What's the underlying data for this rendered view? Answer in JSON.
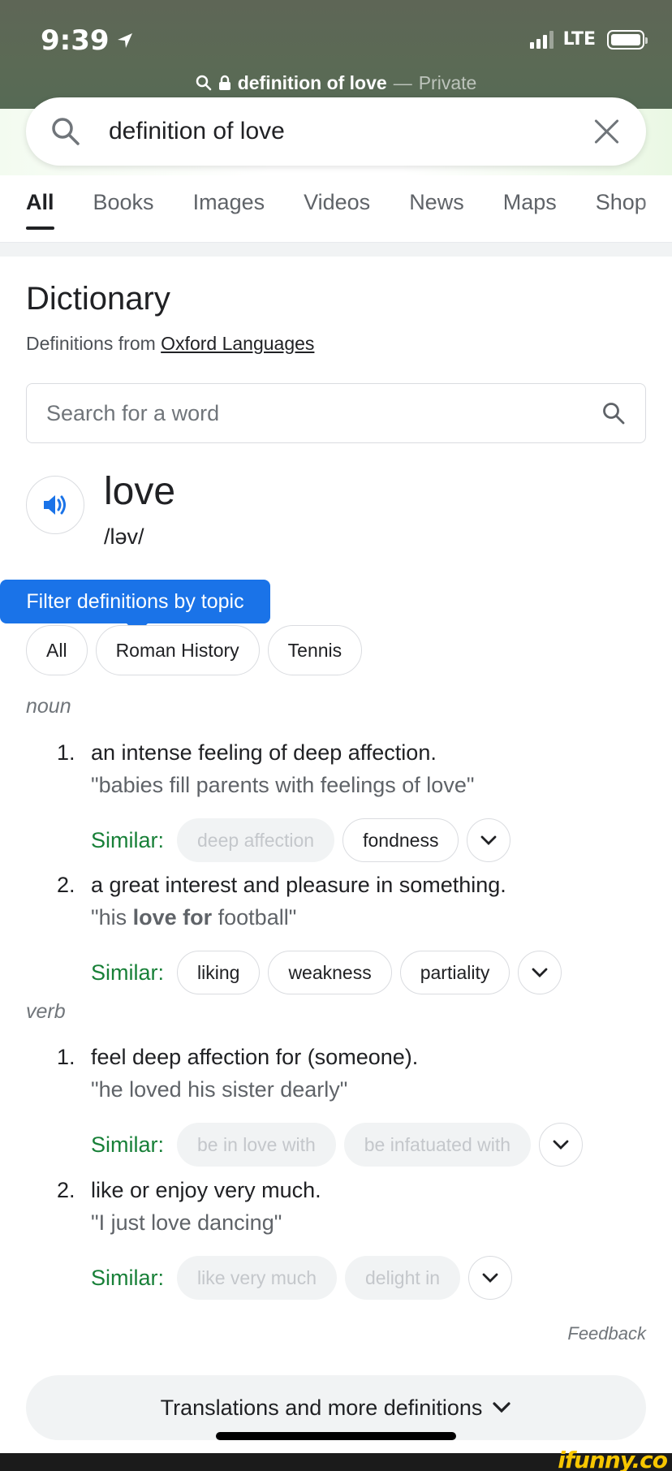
{
  "status_bar": {
    "time": "9:39",
    "network": "LTE"
  },
  "url_bar": {
    "query": "definition of love",
    "separator": "—",
    "mode": "Private"
  },
  "search": {
    "query": "definition of love"
  },
  "tabs": [
    {
      "label": "All",
      "active": true
    },
    {
      "label": "Books"
    },
    {
      "label": "Images"
    },
    {
      "label": "Videos"
    },
    {
      "label": "News"
    },
    {
      "label": "Maps"
    },
    {
      "label": "Shop"
    }
  ],
  "dictionary": {
    "title": "Dictionary",
    "source_prefix": "Definitions from",
    "source_link": "Oxford Languages",
    "word_search_placeholder": "Search for a word",
    "word": "love",
    "phonetic": "/ləv/",
    "filter_tooltip": "Filter definitions by topic",
    "topics": [
      "All",
      "Roman History",
      "Tennis"
    ],
    "noun": {
      "label": "noun",
      "senses": [
        {
          "num": "1.",
          "definition": "an intense feeling of deep affection.",
          "example": "\"babies fill parents with feelings of love\"",
          "similar_label": "Similar:",
          "similar": [
            {
              "text": "deep affection",
              "disabled": true
            },
            {
              "text": "fondness",
              "disabled": false
            }
          ]
        },
        {
          "num": "2.",
          "definition": "a great interest and pleasure in something.",
          "example_pre": "\"his ",
          "example_bold": "love for",
          "example_post": " football\"",
          "similar_label": "Similar:",
          "similar": [
            {
              "text": "liking",
              "disabled": false
            },
            {
              "text": "weakness",
              "disabled": false
            },
            {
              "text": "partiality",
              "disabled": false
            }
          ]
        }
      ]
    },
    "verb": {
      "label": "verb",
      "senses": [
        {
          "num": "1.",
          "definition": "feel deep affection for (someone).",
          "example": "\"he loved his sister dearly\"",
          "similar_label": "Similar:",
          "similar": [
            {
              "text": "be in love with",
              "disabled": true
            },
            {
              "text": "be infatuated with",
              "disabled": true
            }
          ]
        },
        {
          "num": "2.",
          "definition": "like or enjoy very much.",
          "example": "\"I just love dancing\"",
          "similar_label": "Similar:",
          "similar": [
            {
              "text": "like very much",
              "disabled": true
            },
            {
              "text": "delight in",
              "disabled": true
            }
          ]
        }
      ]
    },
    "feedback": "Feedback",
    "more_definitions": "Translations and more definitions"
  },
  "colors": {
    "accent_blue": "#1a73e8",
    "similar_green": "#188038",
    "header_bg": "#5b6a55"
  },
  "watermark": "ifunny.co"
}
